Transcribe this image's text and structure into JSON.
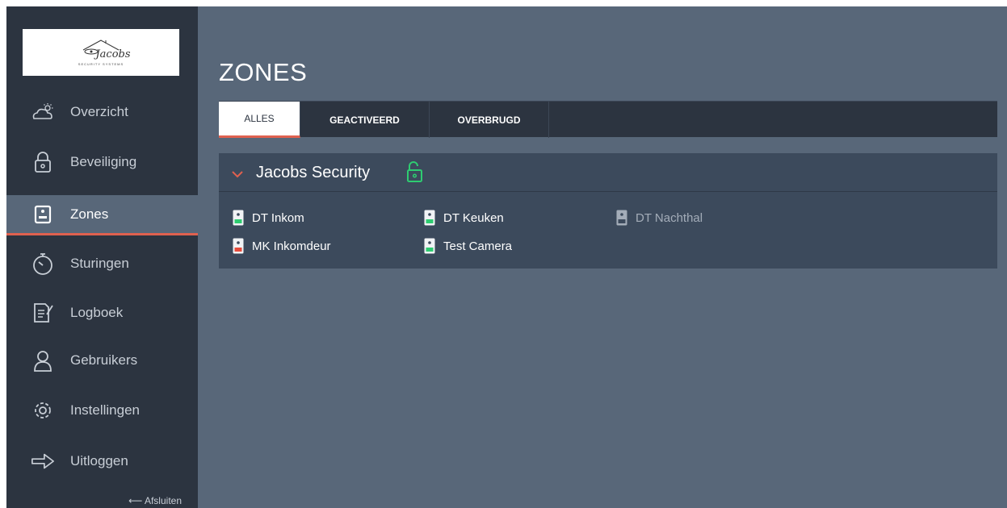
{
  "sidebar": {
    "logo": {
      "script": "Jacobs",
      "tagline": "SECURITY SYSTEMS"
    },
    "items": [
      {
        "label": "Overzicht",
        "icon": "weather-icon"
      },
      {
        "label": "Beveiliging",
        "icon": "lock-icon"
      },
      {
        "label": "Zones",
        "icon": "zone-sensor-icon",
        "active": true
      },
      {
        "label": "Sturingen",
        "icon": "timer-icon"
      },
      {
        "label": "Logboek",
        "icon": "logbook-icon"
      },
      {
        "label": "Gebruikers",
        "icon": "user-icon"
      },
      {
        "label": "Instellingen",
        "icon": "gear-icon"
      },
      {
        "label": "Uitloggen",
        "icon": "logout-arrow-icon"
      }
    ],
    "close_label": "⟵ Afsluiten"
  },
  "main": {
    "title": "ZONES",
    "tabs": [
      {
        "label": "ALLES",
        "active": true
      },
      {
        "label": "GEACTIVEERD"
      },
      {
        "label": "OVERBRUGD"
      }
    ],
    "group": {
      "name": "Jacobs Security",
      "lock_state": "unlocked",
      "zones": [
        {
          "label": "DT Inkom",
          "status": "ok"
        },
        {
          "label": "DT Keuken",
          "status": "ok"
        },
        {
          "label": "DT Nachthal",
          "status": "inactive"
        },
        {
          "label": "MK Inkomdeur",
          "status": "alarm"
        },
        {
          "label": "Test Camera",
          "status": "ok"
        }
      ]
    }
  },
  "colors": {
    "sidebar_bg": "#2c3440",
    "main_bg": "#586779",
    "panel_bg": "#3c4a5c",
    "accent_red": "#e0614f",
    "status_green": "#2ecc71",
    "status_red": "#e74c3c",
    "lock_green": "#2ecc71"
  }
}
